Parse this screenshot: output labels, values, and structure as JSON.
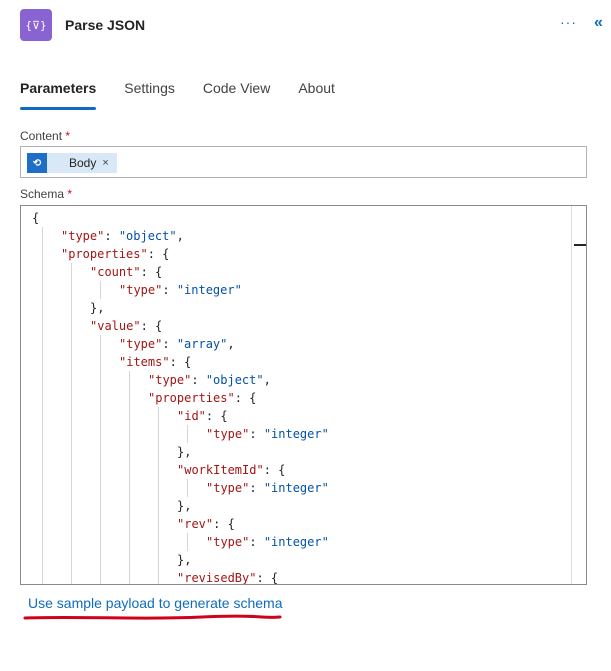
{
  "header": {
    "icon_glyph": "{⊽}",
    "title": "Parse JSON",
    "more_label": "···",
    "collapse_label": "«"
  },
  "tabs": [
    {
      "label": "Parameters",
      "active": true
    },
    {
      "label": "Settings",
      "active": false
    },
    {
      "label": "Code View",
      "active": false
    },
    {
      "label": "About",
      "active": false
    }
  ],
  "content": {
    "label": "Content",
    "required_mark": "*",
    "token_label": "Body",
    "token_remove": "×"
  },
  "schema": {
    "label": "Schema",
    "required_mark": "*",
    "lines": [
      {
        "indent": 0,
        "parts": [
          [
            "p",
            "{"
          ]
        ]
      },
      {
        "indent": 1,
        "parts": [
          [
            "k",
            "\"type\""
          ],
          [
            "p",
            ": "
          ],
          [
            "s",
            "\"object\""
          ],
          [
            "p",
            ","
          ]
        ]
      },
      {
        "indent": 1,
        "parts": [
          [
            "k",
            "\"properties\""
          ],
          [
            "p",
            ": {"
          ]
        ]
      },
      {
        "indent": 2,
        "parts": [
          [
            "k",
            "\"count\""
          ],
          [
            "p",
            ": {"
          ]
        ]
      },
      {
        "indent": 3,
        "parts": [
          [
            "k",
            "\"type\""
          ],
          [
            "p",
            ": "
          ],
          [
            "s",
            "\"integer\""
          ]
        ]
      },
      {
        "indent": 2,
        "parts": [
          [
            "p",
            "},"
          ]
        ]
      },
      {
        "indent": 2,
        "parts": [
          [
            "k",
            "\"value\""
          ],
          [
            "p",
            ": {"
          ]
        ]
      },
      {
        "indent": 3,
        "parts": [
          [
            "k",
            "\"type\""
          ],
          [
            "p",
            ": "
          ],
          [
            "s",
            "\"array\""
          ],
          [
            "p",
            ","
          ]
        ]
      },
      {
        "indent": 3,
        "parts": [
          [
            "k",
            "\"items\""
          ],
          [
            "p",
            ": {"
          ]
        ]
      },
      {
        "indent": 4,
        "parts": [
          [
            "k",
            "\"type\""
          ],
          [
            "p",
            ": "
          ],
          [
            "s",
            "\"object\""
          ],
          [
            "p",
            ","
          ]
        ]
      },
      {
        "indent": 4,
        "parts": [
          [
            "k",
            "\"properties\""
          ],
          [
            "p",
            ": {"
          ]
        ]
      },
      {
        "indent": 5,
        "parts": [
          [
            "k",
            "\"id\""
          ],
          [
            "p",
            ": {"
          ]
        ]
      },
      {
        "indent": 6,
        "parts": [
          [
            "k",
            "\"type\""
          ],
          [
            "p",
            ": "
          ],
          [
            "s",
            "\"integer\""
          ]
        ]
      },
      {
        "indent": 5,
        "parts": [
          [
            "p",
            "},"
          ]
        ]
      },
      {
        "indent": 5,
        "parts": [
          [
            "k",
            "\"workItemId\""
          ],
          [
            "p",
            ": {"
          ]
        ]
      },
      {
        "indent": 6,
        "parts": [
          [
            "k",
            "\"type\""
          ],
          [
            "p",
            ": "
          ],
          [
            "s",
            "\"integer\""
          ]
        ]
      },
      {
        "indent": 5,
        "parts": [
          [
            "p",
            "},"
          ]
        ]
      },
      {
        "indent": 5,
        "parts": [
          [
            "k",
            "\"rev\""
          ],
          [
            "p",
            ": {"
          ]
        ]
      },
      {
        "indent": 6,
        "parts": [
          [
            "k",
            "\"type\""
          ],
          [
            "p",
            ": "
          ],
          [
            "s",
            "\"integer\""
          ]
        ]
      },
      {
        "indent": 5,
        "parts": [
          [
            "p",
            "},"
          ]
        ]
      },
      {
        "indent": 5,
        "parts": [
          [
            "k",
            "\"revisedBy\""
          ],
          [
            "p",
            ": {"
          ]
        ]
      }
    ]
  },
  "sample_link": "Use sample payload to generate schema",
  "colors": {
    "accent": "#0f6cbd",
    "icon_bg": "#8a63d2",
    "key": "#a31515",
    "string": "#0451a5",
    "annotation_underline": "#d0021b"
  }
}
